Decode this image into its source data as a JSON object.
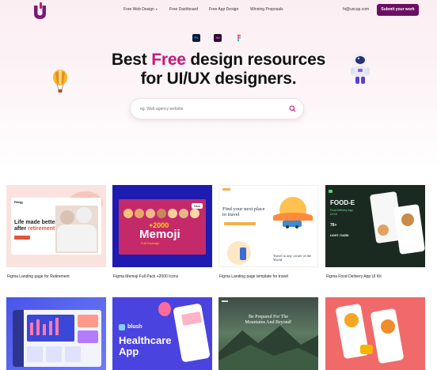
{
  "header": {
    "nav": [
      {
        "label": "Free Web Design",
        "has_caret": true
      },
      {
        "label": "Free Dashboard"
      },
      {
        "label": "Free App Design"
      },
      {
        "label": "Winning Proposals"
      }
    ],
    "email": "hi@uxcup.com",
    "submit_label": "Submit your work"
  },
  "hero": {
    "tools": [
      "Ps",
      "Xd",
      "F"
    ],
    "title_prefix": "Best ",
    "title_highlight": "Free",
    "title_rest": " design resources",
    "title_line2": "for UI/UX designers.",
    "search_placeholder": "eg. Web agency website"
  },
  "cards": [
    {
      "label": "Figma Landing page for Retirement",
      "thumb": {
        "brand": "Pittrgy",
        "line1": "Life made better",
        "line2": "after ",
        "line2_hl": "retirement"
      }
    },
    {
      "label": "Figma Memoji Full Pack +2000 Icons",
      "thumb": {
        "badge": "New",
        "count": "+2000",
        "title": "Memoji",
        "subtitle": "Full Package"
      }
    },
    {
      "label": "Figma Landing page template for travel",
      "thumb": {
        "headline1": "Find your next place",
        "headline2": "to travel",
        "foot1": "Travel to any corner of the",
        "foot2": "World"
      }
    },
    {
      "label": "Figma Food Delivery App UI Kit",
      "thumb": {
        "title": "FOOD-E",
        "sub1": "Food Delivery App",
        "sub2": "UI Kit",
        "stat1": "76+",
        "stat2": "LIGHT / DARK"
      }
    }
  ],
  "cards_row2": [
    {
      "thumb": {}
    },
    {
      "thumb": {
        "brand": "blush",
        "title1": "Healthcare",
        "title2": "App"
      }
    },
    {
      "thumb": {
        "line1": "Be Prepared For The",
        "line2": "Mountains And Beyond!"
      }
    },
    {
      "thumb": {}
    }
  ],
  "colors": {
    "accent": "#c4197a",
    "button": "#6b0f63",
    "hero_bg": "#fbeef2"
  }
}
